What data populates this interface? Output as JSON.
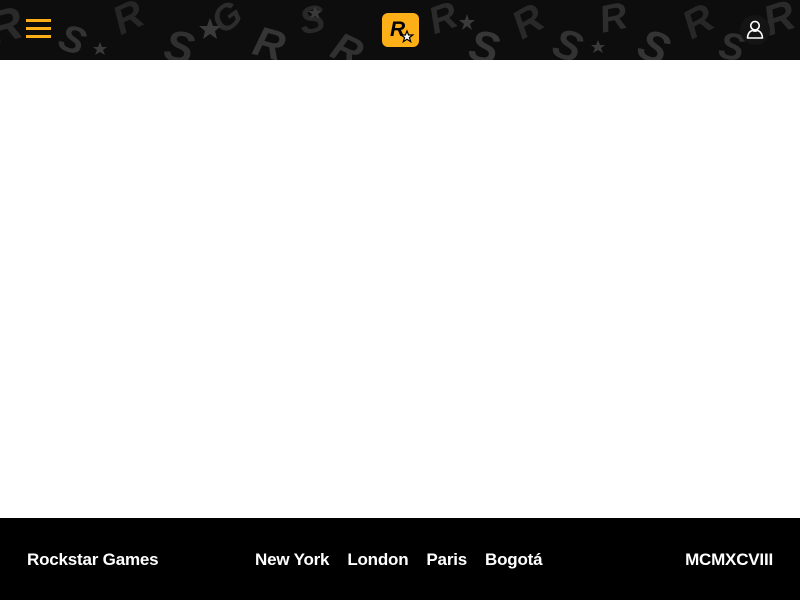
{
  "header": {
    "menu_icon": "hamburger-menu-icon",
    "logo": {
      "letter": "R",
      "icon": "rockstar-logo-icon"
    },
    "account_icon": "user-account-icon"
  },
  "footer": {
    "brand": "Rockstar Games",
    "cities": [
      "New York",
      "London",
      "Paris",
      "Bogotá"
    ],
    "year": "MCMXCVIII"
  },
  "colors": {
    "accent": "#fcaf17",
    "header_bg": "#0d0d0d",
    "footer_bg": "#000000",
    "footer_text": "#ffffff",
    "main_bg": "#ffffff"
  }
}
